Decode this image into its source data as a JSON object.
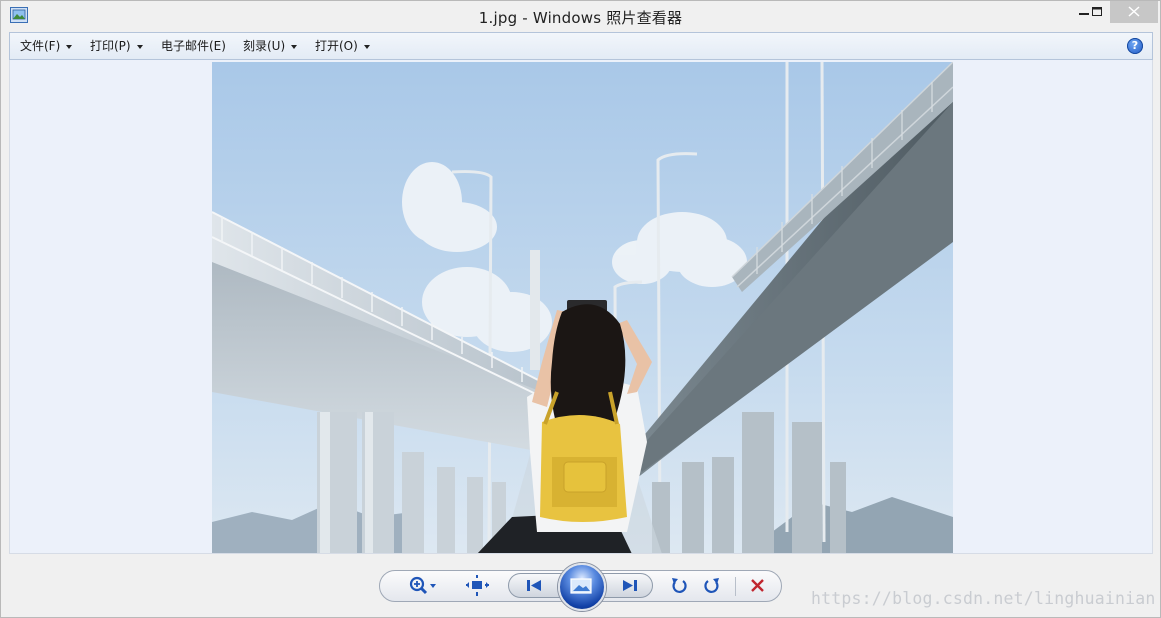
{
  "window": {
    "title": "1.jpg - Windows 照片查看器"
  },
  "menu": {
    "items": [
      {
        "label": "文件(F)",
        "has_dropdown": true
      },
      {
        "label": "打印(P)",
        "has_dropdown": true
      },
      {
        "label": "电子邮件(E)",
        "has_dropdown": false
      },
      {
        "label": "刻录(U)",
        "has_dropdown": true
      },
      {
        "label": "打开(O)",
        "has_dropdown": true
      }
    ],
    "help_label": "?"
  },
  "image": {
    "description_icon": "photo-viewer-image"
  },
  "controls": {
    "zoom_icon": "zoom-icon",
    "fit_icon": "actual-size-icon",
    "previous_icon": "previous-icon",
    "slideshow_icon": "slideshow-icon",
    "next_icon": "next-icon",
    "rotate_ccw_icon": "rotate-counterclockwise-icon",
    "rotate_cw_icon": "rotate-clockwise-icon",
    "delete_icon": "delete-icon"
  },
  "colors": {
    "accent_blue": "#1c56c4",
    "delete_red": "#c0262f",
    "menu_bg": "#e8eef7",
    "content_bg": "#ecf1fa"
  },
  "watermark": "https://blog.csdn.net/linghuainian"
}
